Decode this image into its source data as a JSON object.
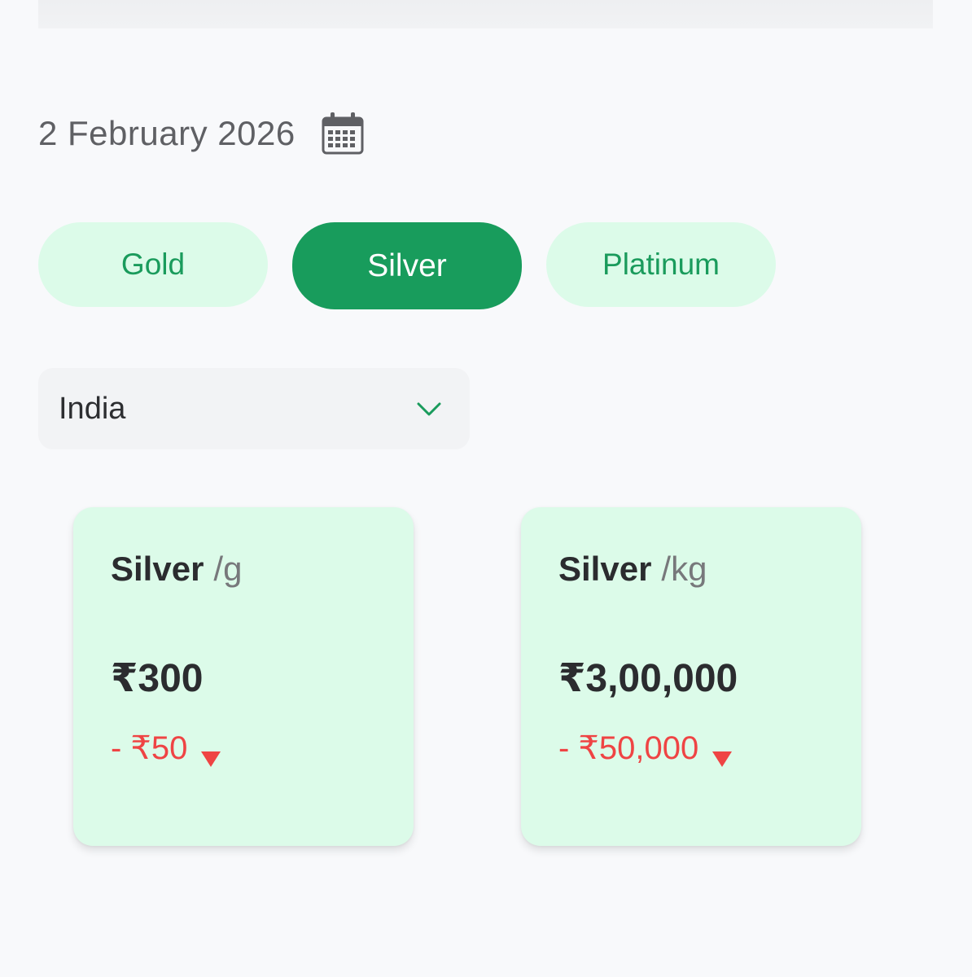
{
  "header": {
    "date": "2 February 2026",
    "calendar_icon": "calendar-icon"
  },
  "tabs": [
    {
      "label": "Gold",
      "active": false
    },
    {
      "label": "Silver",
      "active": true
    },
    {
      "label": "Platinum",
      "active": false
    }
  ],
  "country_select": {
    "value": "India",
    "icon": "chevron-down-icon"
  },
  "cards": [
    {
      "metal": "Silver",
      "unit": "/g",
      "price": "₹300",
      "change": "- ₹50",
      "direction": "down"
    },
    {
      "metal": "Silver",
      "unit": "/kg",
      "price": "₹3,00,000",
      "change": "- ₹50,000",
      "direction": "down"
    }
  ],
  "colors": {
    "background": "#f8f9fb",
    "accent": "#189c5c",
    "tab_inactive_bg": "#dcfbe9",
    "card_bg": "#dcfbe9",
    "negative": "#ef4444",
    "text_primary": "#2b2c2f",
    "text_muted": "#77787b"
  }
}
